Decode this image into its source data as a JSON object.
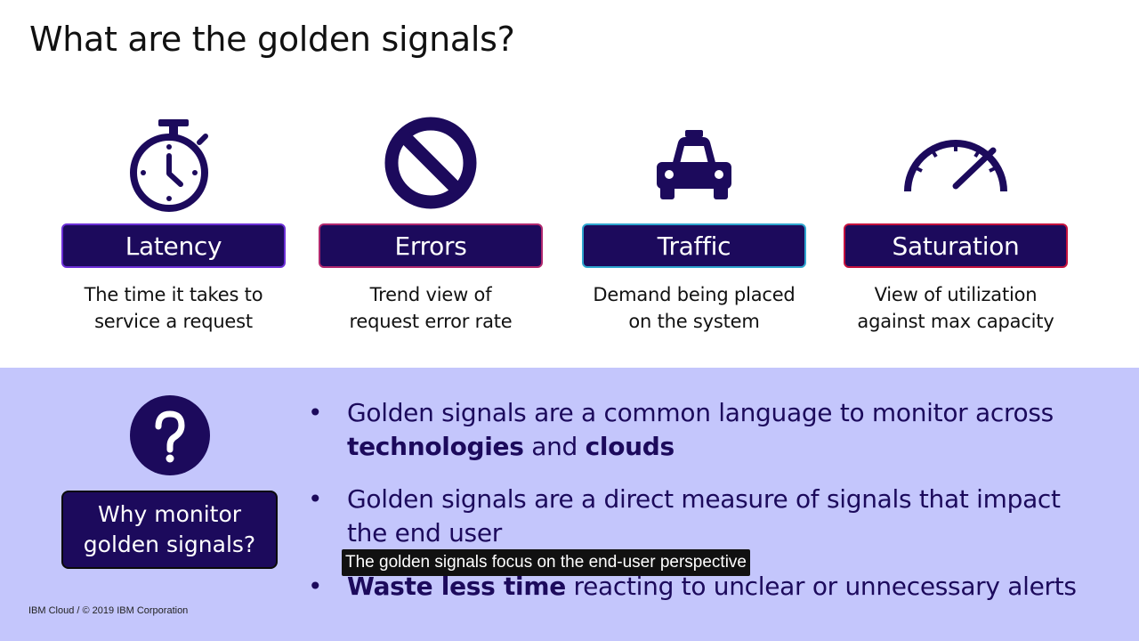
{
  "slide": {
    "title": "What are the golden signals?"
  },
  "signals": [
    {
      "label": "Latency",
      "icon": "stopwatch-icon",
      "desc_line1": "The time it takes to",
      "desc_line2": "service a request",
      "border_color": "#6b2fd6"
    },
    {
      "label": "Errors",
      "icon": "prohibited-icon",
      "desc_line1": "Trend view of",
      "desc_line2": "request error rate",
      "border_color": "#b0286e"
    },
    {
      "label": "Traffic",
      "icon": "taxi-icon",
      "desc_line1": "Demand being placed",
      "desc_line2": "on the system",
      "border_color": "#2fa6cf"
    },
    {
      "label": "Saturation",
      "icon": "gauge-icon",
      "desc_line1": "View of utilization",
      "desc_line2": "against max capacity",
      "border_color": "#c4123e"
    }
  ],
  "why": {
    "icon": "question-mark-icon",
    "line1": "Why monitor",
    "line2": "golden signals?"
  },
  "bullets": [
    {
      "line1": "Golden signals are a common language to monitor across",
      "bold1": "technologies",
      "mid": " and ",
      "bold2": "clouds"
    },
    {
      "line1": "Golden signals are a direct measure of signals that impact",
      "line2": "the end user"
    },
    {
      "bold": "Waste less time",
      "rest": " reacting to unclear or unnecessary alerts"
    }
  ],
  "caption": "The golden signals focus on the end-user perspective",
  "footer": "IBM Cloud / © 2019 IBM Corporation",
  "colors": {
    "navy": "#1c0a5c",
    "panel": "#c4c6fc"
  }
}
